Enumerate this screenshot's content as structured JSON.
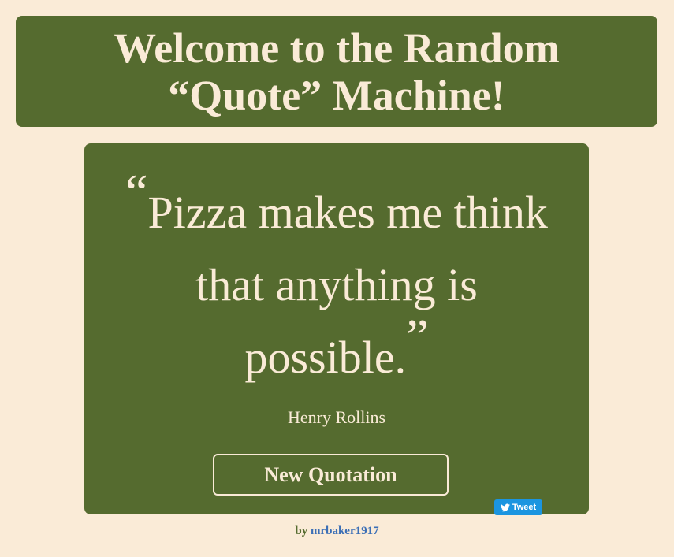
{
  "header": {
    "title": "Welcome to the Random “Quote” Machine!"
  },
  "quote": {
    "open_mark": "“",
    "text": "Pizza makes me think that anything is possible.",
    "close_mark": "”",
    "author": "Henry Rollins"
  },
  "actions": {
    "new_quote_label": "New Quotation",
    "tweet_label": "Tweet",
    "tweet_icon": "twitter-bird-icon"
  },
  "footer": {
    "by_label": "by",
    "author_link": "mrbaker1917"
  },
  "colors": {
    "background": "#faebd7",
    "panel": "#556b2f",
    "text": "#faebd7",
    "tweet": "#1b95e0",
    "link": "#3b6fb6"
  }
}
